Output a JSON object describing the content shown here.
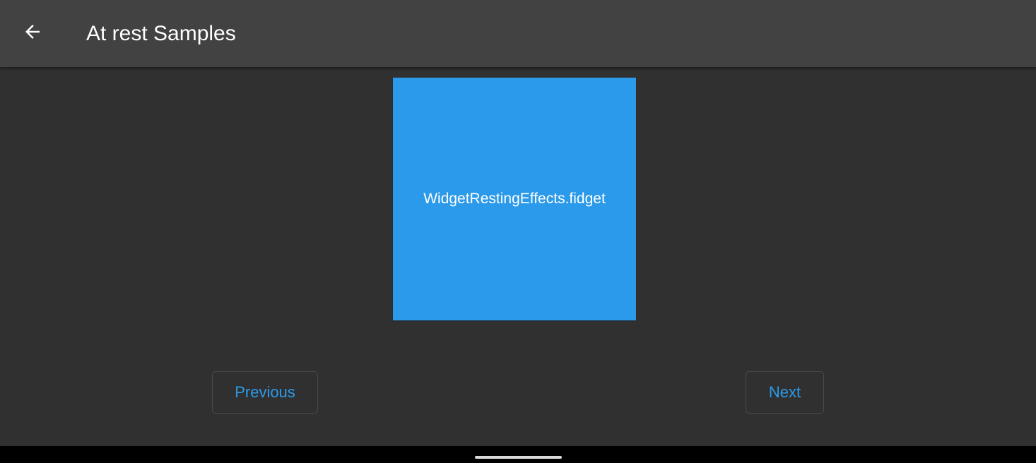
{
  "app_bar": {
    "title": "At rest Samples",
    "back_icon": "arrow-back-icon"
  },
  "sample": {
    "label": "WidgetRestingEffects.fidget",
    "color": "#2c9aea"
  },
  "navigation": {
    "previous_label": "Previous",
    "next_label": "Next"
  },
  "theme": {
    "background": "#303030",
    "app_bar": "#424242",
    "accent": "#2c9aea"
  }
}
